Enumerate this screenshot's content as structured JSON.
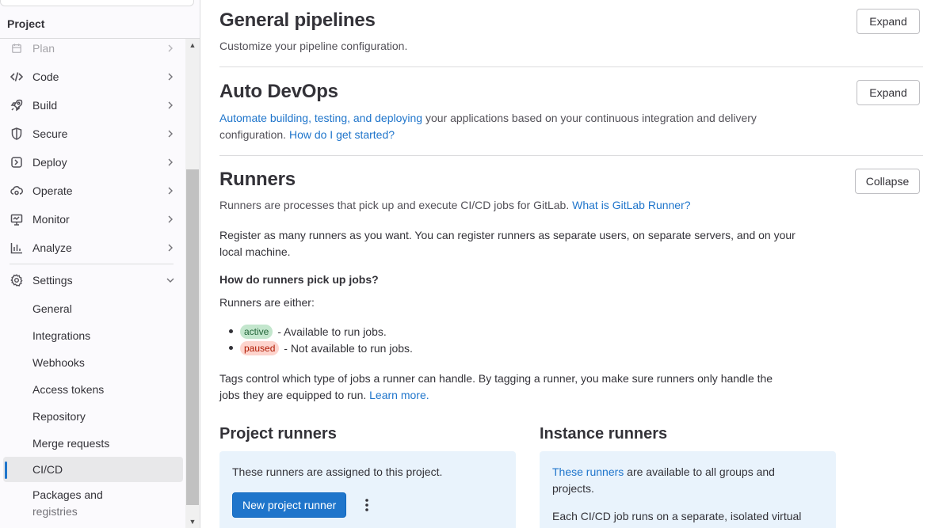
{
  "sidebar": {
    "section_title": "Project",
    "items": [
      {
        "label": "Plan",
        "icon": "calendar-icon",
        "faded": true
      },
      {
        "label": "Code",
        "icon": "code-icon"
      },
      {
        "label": "Build",
        "icon": "rocket-icon"
      },
      {
        "label": "Secure",
        "icon": "shield-icon"
      },
      {
        "label": "Deploy",
        "icon": "deploy-icon"
      },
      {
        "label": "Operate",
        "icon": "cloud-gear-icon"
      },
      {
        "label": "Monitor",
        "icon": "monitor-icon"
      },
      {
        "label": "Analyze",
        "icon": "chart-icon"
      }
    ],
    "settings": {
      "label": "Settings",
      "icon": "gear-icon",
      "expanded": true,
      "subitems": [
        {
          "label": "General"
        },
        {
          "label": "Integrations"
        },
        {
          "label": "Webhooks"
        },
        {
          "label": "Access tokens"
        },
        {
          "label": "Repository"
        },
        {
          "label": "Merge requests"
        },
        {
          "label": "CI/CD",
          "active": true
        },
        {
          "label": "Packages and",
          "label2": "registries"
        }
      ]
    }
  },
  "general_pipelines": {
    "title": "General pipelines",
    "description": "Customize your pipeline configuration.",
    "button": "Expand"
  },
  "auto_devops": {
    "title": "Auto DevOps",
    "link1": "Automate building, testing, and deploying",
    "text1": " your applications based on your continuous integration and delivery",
    "text2": "configuration.",
    "link2": "How do I get started?",
    "button": "Expand"
  },
  "runners": {
    "title": "Runners",
    "description": "Runners are processes that pick up and execute CI/CD jobs for GitLab.",
    "description_link": "What is GitLab Runner?",
    "button": "Collapse",
    "register_line1": "Register as many runners as you want. You can register runners as separate users, on separate servers, and on your",
    "register_line2": "local machine.",
    "how_heading": "How do runners pick up jobs?",
    "either": "Runners are either:",
    "active_badge": "active",
    "active_text": " - Available to run jobs.",
    "paused_badge": "paused",
    "paused_text": " - Not available to run jobs.",
    "tags_line1": "Tags control which type of jobs a runner can handle. By tagging a runner, you make sure runners only handle the",
    "tags_line2": "jobs they are equipped to run.",
    "tags_link": "Learn more.",
    "project_runners": {
      "title": "Project runners",
      "text": "These runners are assigned to this project.",
      "button": "New project runner"
    },
    "instance_runners": {
      "title": "Instance runners",
      "link": "These runners",
      "text1": " are available to all groups and",
      "text2": "projects.",
      "text3": "Each CI/CD job runs on a separate, isolated virtual"
    }
  },
  "colors": {
    "link": "#1f75cb",
    "primary": "#1f75cb",
    "card": "#e9f3fc"
  }
}
